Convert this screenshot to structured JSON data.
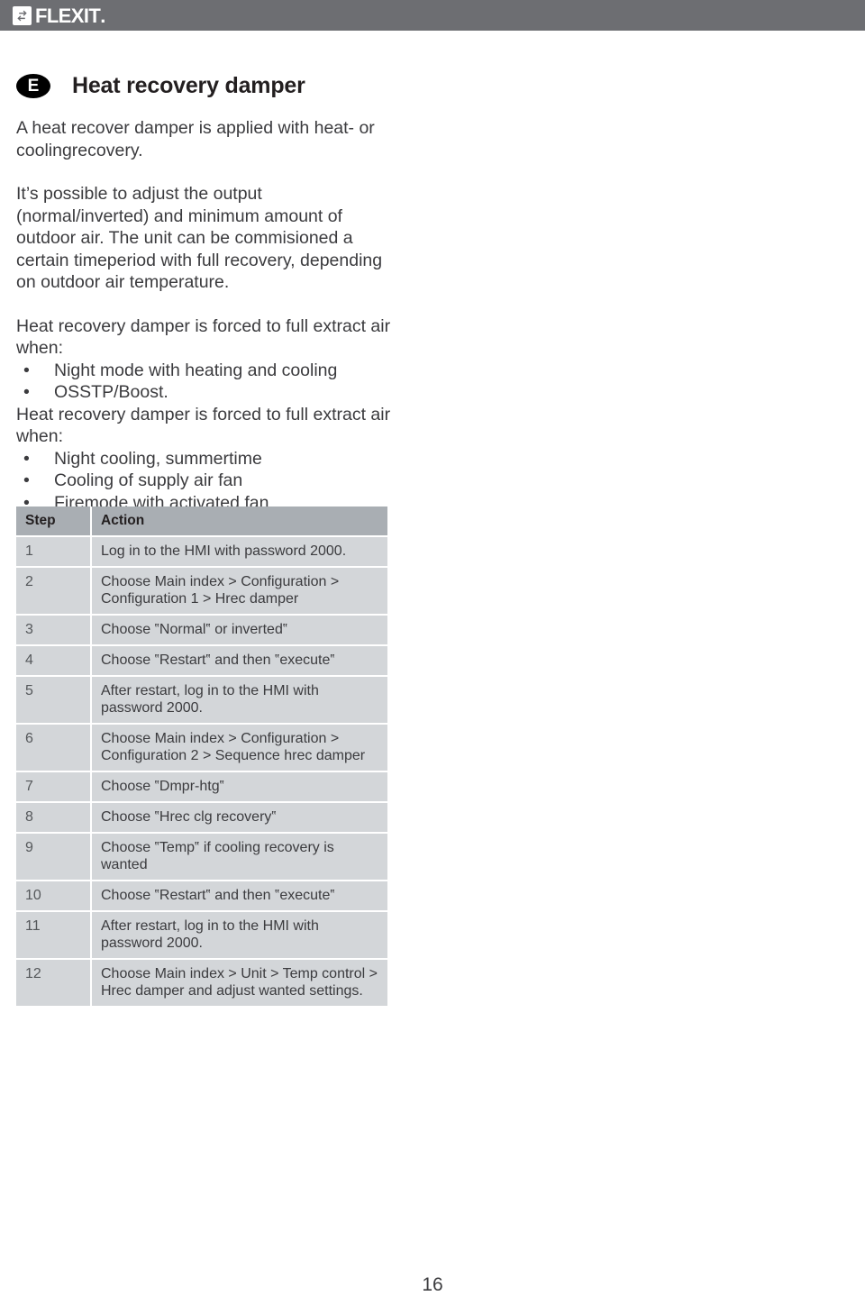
{
  "brand": {
    "name": "FLEXIT",
    "trademark_dot": ".",
    "logo_icon": "exchange-arrows-icon",
    "bar_color": "#6d6e72"
  },
  "section": {
    "badge_letter": "E",
    "title": "Heat recovery damper"
  },
  "body": {
    "paragraph_1": "A heat recover damper is applied with heat- or coolingrecovery.",
    "paragraph_2": "It’s possible to adjust the output (normal/inverted) and minimum amount of outdoor air. The unit can be commisioned a certain timeperiod with full recovery, depending on outdoor air temperature.",
    "forced_intro_1": "Heat recovery damper is forced to full extract air when:",
    "forced_list_1": [
      "Night mode  with heating and cooling",
      "OSSTP/Boost."
    ],
    "forced_intro_2": "Heat recovery damper is forced to full extract air when:",
    "forced_list_2": [
      "Night cooling, summertime",
      "Cooling of supply air fan",
      "Firemode with activated fan"
    ],
    "bullet_glyph": "•"
  },
  "table": {
    "headers": [
      "Step",
      "Action"
    ],
    "rows": [
      {
        "step": "1",
        "action": "Log in to the HMI with password 2000."
      },
      {
        "step": "2",
        "action": "Choose Main index > Configuration > Configuration 1 > Hrec damper"
      },
      {
        "step": "3",
        "action": "Choose ‟Normal‟ or inverted‟"
      },
      {
        "step": "4",
        "action": "Choose ‟Restart‟ and then ‟execute‟"
      },
      {
        "step": "5",
        "action": "After restart, log in to the HMI with password 2000."
      },
      {
        "step": "6",
        "action": "Choose Main index > Configuration > Configuration 2 > Sequence hrec damper"
      },
      {
        "step": "7",
        "action": "Choose ‟Dmpr-htg‟"
      },
      {
        "step": "8",
        "action": "Choose ‟Hrec clg recovery‟"
      },
      {
        "step": "9",
        "action": "Choose ‟Temp‟ if cooling recovery is wanted"
      },
      {
        "step": "10",
        "action": "Choose ‟Restart‟ and then ‟execute‟"
      },
      {
        "step": "11",
        "action": "After restart, log in to the HMI with password 2000."
      },
      {
        "step": "12",
        "action": "Choose Main index > Unit > Temp control > Hrec damper and adjust wanted settings."
      }
    ],
    "header_color": "#a9aeb3",
    "row_color": "#d3d6d9"
  },
  "footer": {
    "page_number": "16"
  }
}
